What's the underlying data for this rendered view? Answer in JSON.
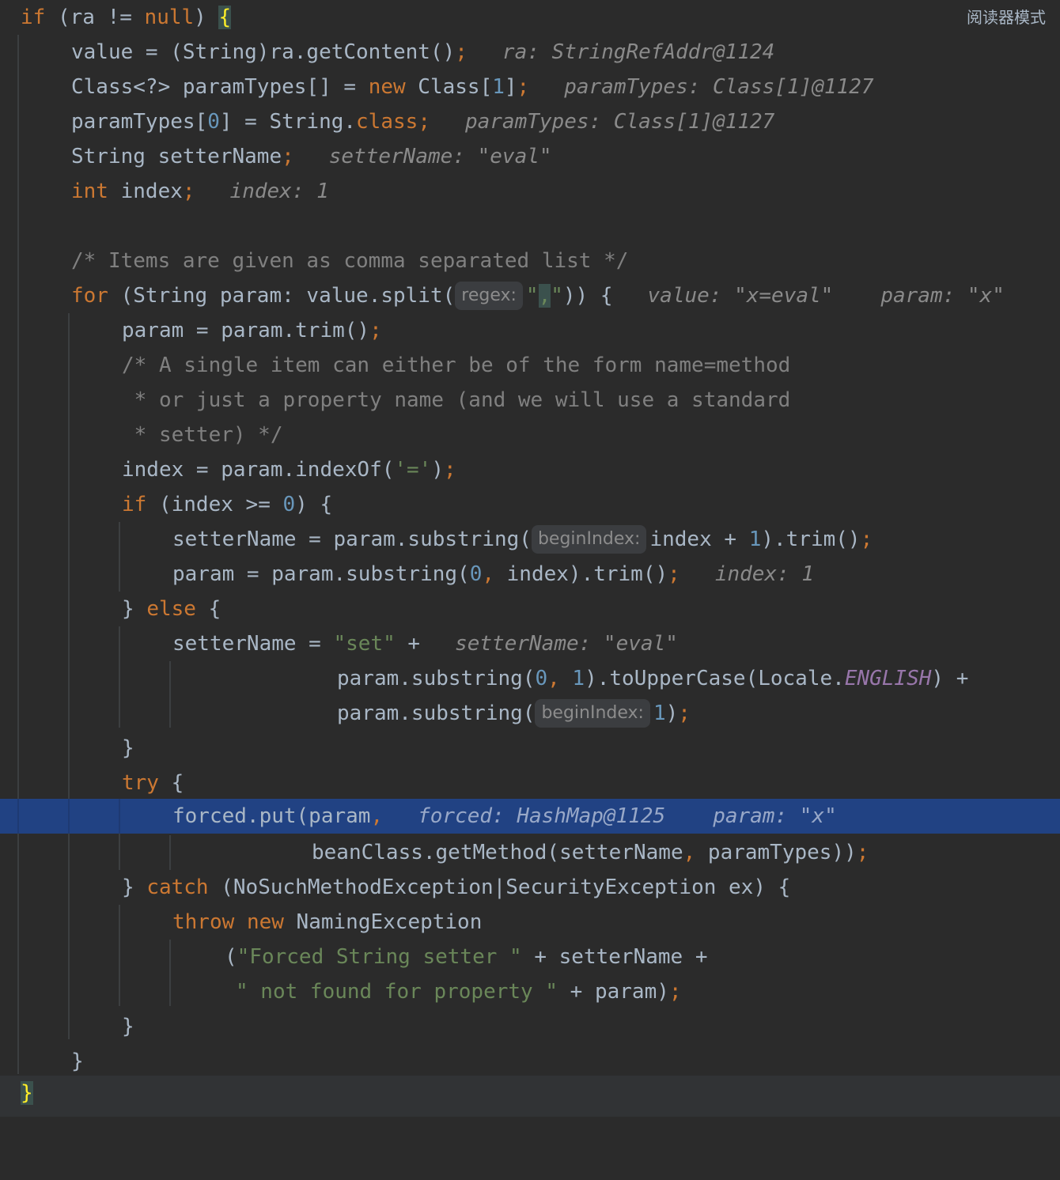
{
  "reader_mode_label": "阅读器模式",
  "debug": {
    "ra": "ra: StringRefAddr@1124",
    "paramTypes_new": "paramTypes: Class[1]@1127",
    "paramTypes_set": "paramTypes: Class[1]@1127",
    "setterName": "setterName: \"eval\"",
    "index": "index: 1",
    "value": "value: \"x=eval\"",
    "param_loop": "param: \"x\"",
    "index2": "index: 1",
    "setterName2": "setterName: \"eval\"",
    "forced": "forced: HashMap@1125",
    "param_put": "param: \"x\""
  },
  "hints": {
    "regex": "regex:",
    "beginIndex1": "beginIndex:",
    "beginIndex2": "beginIndex:"
  },
  "code": {
    "l1": {
      "if": "if",
      "cond": " (ra != ",
      "null": "null",
      "close": ") ",
      "brace": "{"
    },
    "l2": {
      "a": "value = (String)ra.getContent()",
      "semi": ";"
    },
    "l3": {
      "a": "Class<?> paramTypes[] = ",
      "new": "new",
      "b": " Class[",
      "n": "1",
      "c": "]",
      "semi": ";"
    },
    "l4": {
      "a": "paramTypes[",
      "n": "0",
      "b": "] = String.",
      "cls": "class",
      "semi": ";"
    },
    "l5": {
      "a": "String setterName",
      "semi": ";"
    },
    "l6": {
      "int": "int",
      "a": " index",
      "semi": ";"
    },
    "l8": {
      "cmt": "/* Items are given as comma separated list */"
    },
    "l9": {
      "for": "for",
      "a": " (String param: value.split(",
      "q1": "\"",
      "comma": ",",
      "q2": "\"",
      "b": ")) {"
    },
    "l10": {
      "a": "param = param.trim()",
      "semi": ";"
    },
    "l11": {
      "cmt": "/* A single item can either be of the form name=method"
    },
    "l12": {
      "cmt": " * or just a property name (and we will use a standard"
    },
    "l13": {
      "cmt": " * setter) */"
    },
    "l14": {
      "a": "index = param.indexOf(",
      "s": "'='",
      "b": ")",
      "semi": ";"
    },
    "l15": {
      "if": "if",
      "a": " (index >= ",
      "n": "0",
      "b": ") {"
    },
    "l16": {
      "a": "setterName = param.substring(",
      "b": "index + ",
      "n": "1",
      "c": ").trim()",
      "semi": ";"
    },
    "l17": {
      "a": "param = param.substring(",
      "n": "0",
      "comma": ",",
      "b": " index).trim()",
      "semi": ";"
    },
    "l18": {
      "a": "} ",
      "else": "else",
      "b": " {"
    },
    "l19": {
      "a": "setterName = ",
      "s": "\"set\"",
      "b": " +"
    },
    "l20": {
      "a": "param.substring(",
      "n1": "0",
      "comma": ",",
      "sp": " ",
      "n2": "1",
      "b": ").toUpperCase(Locale.",
      "st": "ENGLISH",
      "c": ") +"
    },
    "l21": {
      "a": "param.substring(",
      "n": "1",
      "b": ")",
      "semi": ";"
    },
    "l22": {
      "a": "}"
    },
    "l23": {
      "try": "try",
      "a": " {"
    },
    "l24": {
      "a": "forced.put(param",
      "comma": ","
    },
    "l25": {
      "a": "beanClass.getMethod(setterName",
      "comma": ",",
      "b": " paramTypes))",
      "semi": ";"
    },
    "l26": {
      "a": "} ",
      "catch": "catch",
      "b": " (NoSuchMethodException|SecurityException ex) {"
    },
    "l27": {
      "throw": "throw",
      "sp": " ",
      "new": "new",
      "a": " NamingException"
    },
    "l28": {
      "a": "(",
      "s": "\"Forced String setter \"",
      "b": " + setterName +"
    },
    "l29": {
      "s": "\" not found for property \"",
      "b": " + param)",
      "semi": ";"
    },
    "l30": {
      "a": "}"
    },
    "l31": {
      "a": "}"
    },
    "l32": {
      "a": "}"
    }
  }
}
